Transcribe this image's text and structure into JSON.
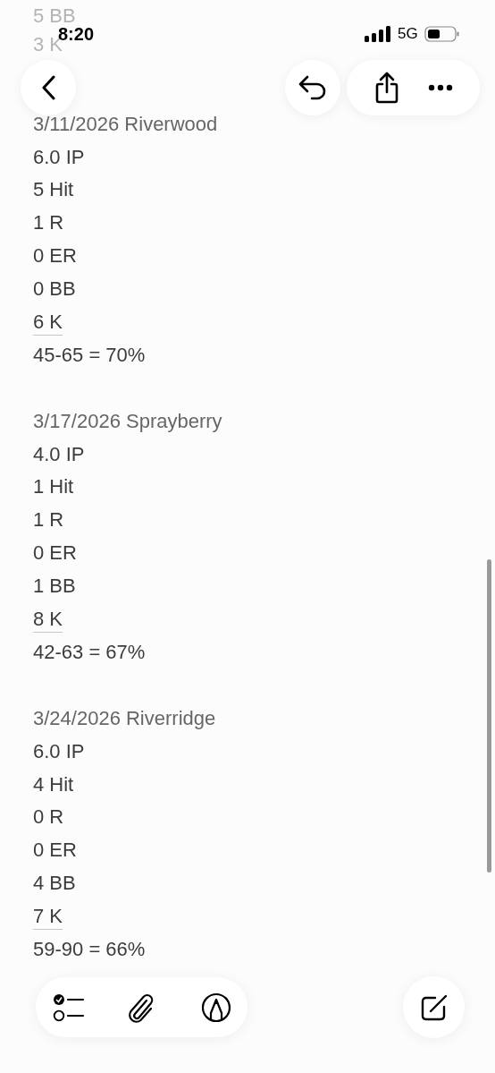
{
  "status_bar": {
    "time": "8:20",
    "network": "5G"
  },
  "faded_lines": [
    "5 BB",
    "3 K"
  ],
  "entries": [
    {
      "header": "3/11/2026 Riverwood",
      "lines": [
        {
          "text": "6.0 IP",
          "underlined": false
        },
        {
          "text": "5 Hit",
          "underlined": false
        },
        {
          "text": "1 R",
          "underlined": false
        },
        {
          "text": "0 ER",
          "underlined": false
        },
        {
          "text": "0 BB",
          "underlined": false
        },
        {
          "text": "6 K",
          "underlined": true
        },
        {
          "text": "45-65 = 70%",
          "underlined": false
        }
      ]
    },
    {
      "header": "3/17/2026 Sprayberry",
      "lines": [
        {
          "text": "4.0 IP",
          "underlined": false
        },
        {
          "text": "1 Hit",
          "underlined": false
        },
        {
          "text": "1 R",
          "underlined": false
        },
        {
          "text": "0 ER",
          "underlined": false
        },
        {
          "text": "1 BB",
          "underlined": false
        },
        {
          "text": "8 K",
          "underlined": true
        },
        {
          "text": "42-63 = 67%",
          "underlined": false
        }
      ]
    },
    {
      "header": "3/24/2026 Riverridge",
      "lines": [
        {
          "text": "6.0 IP",
          "underlined": false
        },
        {
          "text": "4 Hit",
          "underlined": false
        },
        {
          "text": "0 R",
          "underlined": false
        },
        {
          "text": "0 ER",
          "underlined": false
        },
        {
          "text": "4 BB",
          "underlined": false
        },
        {
          "text": "7 K",
          "underlined": true
        },
        {
          "text": "59-90 = 66%",
          "underlined": false
        }
      ]
    }
  ]
}
